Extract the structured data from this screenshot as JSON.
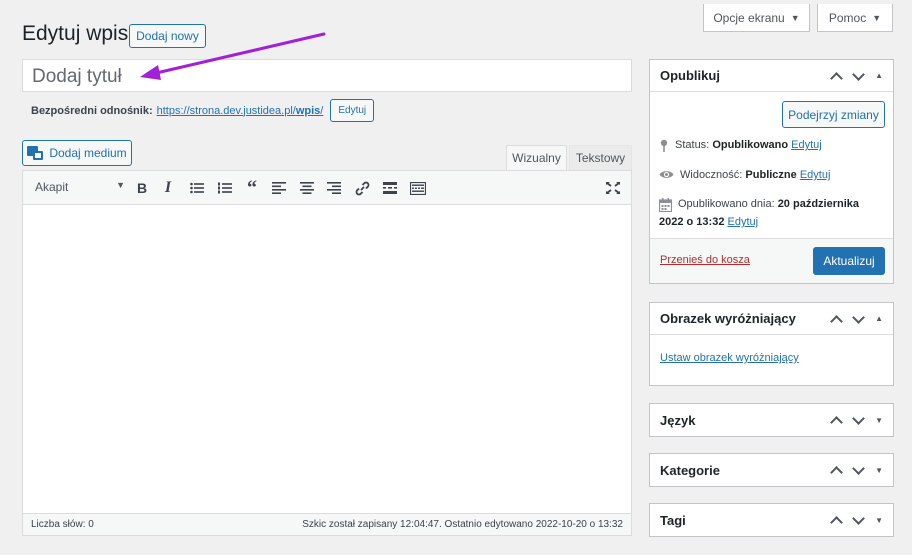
{
  "header": {
    "page_title": "Edytuj wpis",
    "add_new_label": "Dodaj nowy",
    "screen_options_label": "Opcje ekranu",
    "help_label": "Pomoc"
  },
  "post": {
    "title_placeholder": "Dodaj tytuł",
    "permalink_label": "Bezpośredni odnośnik:",
    "permalink_base": "https://strona.dev.justidea.pl/",
    "permalink_slug": "wpis",
    "permalink_trail": "/",
    "permalink_edit_label": "Edytuj"
  },
  "editor": {
    "add_media_label": "Dodaj medium",
    "tab_visual": "Wizualny",
    "tab_text": "Tekstowy",
    "format_value": "Akapit",
    "toolbar_icons": [
      "bold-icon",
      "italic-icon",
      "bullet-list-icon",
      "numbered-list-icon",
      "blockquote-icon",
      "align-left-icon",
      "align-center-icon",
      "align-right-icon",
      "link-icon",
      "read-more-icon",
      "toolbar-toggle-icon",
      "fullscreen-icon"
    ],
    "word_count": "Liczba słów: 0",
    "autosave_status": "Szkic został zapisany 12:04:47. Ostatnio edytowano 2022-10-20 o 13:32"
  },
  "publish_box": {
    "title": "Opublikuj",
    "preview_changes_label": "Podejrzyj zmiany",
    "status_label": "Status:",
    "status_value": "Opublikowano",
    "status_edit": "Edytuj",
    "visibility_label": "Widoczność:",
    "visibility_value": "Publiczne",
    "visibility_edit": "Edytuj",
    "published_label": "Opublikowano dnia:",
    "published_value_line1": "20 października",
    "published_value_line2": "2022 o 13:32",
    "published_edit": "Edytuj",
    "trash_label": "Przenieś do kosza",
    "update_label": "Aktualizuj"
  },
  "featured_image_box": {
    "title": "Obrazek wyróżniający",
    "set_link": "Ustaw obrazek wyróżniający"
  },
  "language_box": {
    "title": "Język"
  },
  "categories_box": {
    "title": "Kategorie"
  },
  "tags_box": {
    "title": "Tagi"
  },
  "colors": {
    "accent": "#2271b1",
    "background": "#f0f0f1",
    "trash": "#b32d2e",
    "annotation_arrow": "#a120d8"
  }
}
